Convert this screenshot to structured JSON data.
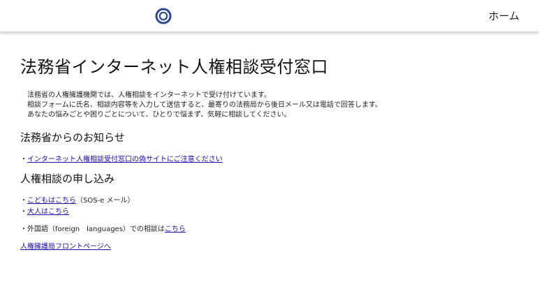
{
  "header": {
    "home_label": "ホーム"
  },
  "page": {
    "title": "法務省インターネット人権相談受付窓口",
    "intro": [
      "法務省の人権擁護機関では、人権相談をインターネットで受け付けています。",
      "相談フォームに氏名、相談内容等を入力して送信すると、最寄りの法務局から後日メール又は電話で回答します。",
      "あなたの悩みごとや困りごとについて、ひとりで悩まず、気軽に相談してください。"
    ]
  },
  "notice": {
    "heading": "法務省からのお知らせ",
    "bullet": "・",
    "link_label": "インターネット人権相談受付窓口の偽サイトにご注意ください"
  },
  "apply": {
    "heading": "人権相談の申し込み",
    "bullet": "・",
    "child_link": "こどもはこちら",
    "child_suffix": "（SOS-e メール）",
    "adult_link": "大人はこちら",
    "foreign_prefix": "外国語（foreign　languages）での相談は",
    "foreign_link": "こちら"
  },
  "footer": {
    "front_link": "人権擁護局フロントページへ"
  },
  "colors": {
    "logo_blue": "#2b4a8c",
    "link": "#1a0dab"
  },
  "icons": {
    "logo": "ring-logo-icon"
  }
}
